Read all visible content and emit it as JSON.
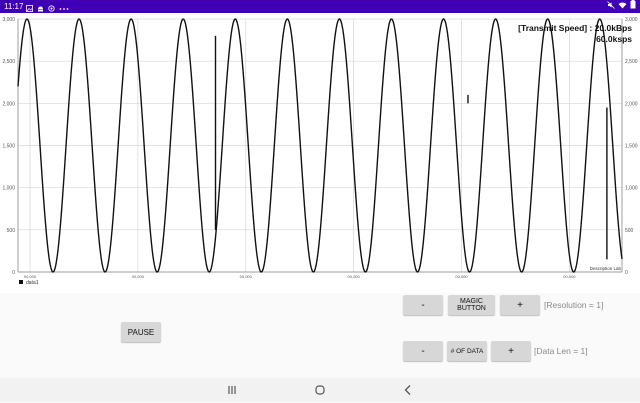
{
  "status_bar": {
    "time": "11:17",
    "icons": [
      "image-icon",
      "android-icon",
      "sync-icon",
      "more-icon"
    ],
    "right_icons": [
      "mute-icon",
      "wifi-icon",
      "battery-icon"
    ],
    "background": "#3f00b5"
  },
  "chart": {
    "speed_line1": "[Transmit Speed] : 20.0kBps",
    "speed_line2": "60.0ksps",
    "legend_label": "data1",
    "description": "Description Lab"
  },
  "chart_data": {
    "type": "line",
    "ylim": [
      0,
      3000
    ],
    "y_ticks": [
      "0",
      "500",
      "1,000",
      "1,500",
      "2,000",
      "2,500",
      "3,000"
    ],
    "x_ticks": [
      "00,000",
      "00,000",
      "00,000",
      "00,000",
      "00,000",
      "00,000"
    ],
    "grid": true,
    "legend": "bottom-left",
    "series": [
      {
        "name": "data1",
        "color": "#111111",
        "wave": {
          "min": 0,
          "max": 3000,
          "cycles": 11.6,
          "start_value": 2200
        },
        "spikes": [
          {
            "at_fraction": 0.327,
            "from": 2800,
            "to": 500
          },
          {
            "at_fraction": 0.745,
            "from": 2100,
            "to": 2000
          },
          {
            "at_fraction": 0.975,
            "from": 150,
            "to": 1950
          }
        ]
      }
    ]
  },
  "controls": {
    "minus_label": "-",
    "plus_label": "+",
    "magic_label": "MAGIC BUTTON",
    "data_label": "# OF DATA",
    "resolution_text": "[Resolution = 1]",
    "datalen_text": "[Data Len = 1]",
    "pause_label": "PAUSE"
  },
  "nav": {
    "icons": [
      "recents-icon",
      "home-icon",
      "back-icon"
    ]
  }
}
